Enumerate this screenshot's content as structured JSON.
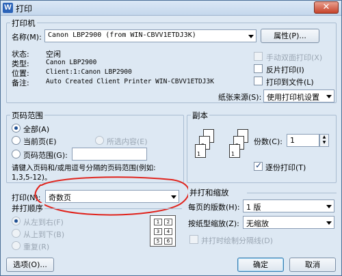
{
  "window": {
    "title": "打印",
    "app_icon": "W"
  },
  "printer": {
    "group_title": "打印机",
    "name_label": "名称(M):",
    "name_value": "Canon LBP2900 (from WIN-CBVV1ETDJ3K)",
    "properties_button": "属性(P)...",
    "status_label": "状态:",
    "status_value": "空闲",
    "type_label": "类型:",
    "type_value": "Canon LBP2900",
    "location_label": "位置:",
    "location_value": "Client:1:Canon LBP2900",
    "comment_label": "备注:",
    "comment_value": "Auto Created Client Printer WIN-CBVV1ETDJ3K",
    "manual_duplex": "手动双面打印(X)",
    "reverse_print": "反片打印(I)",
    "print_to_file": "打印到文件(L)",
    "paper_source_label": "纸张来源(S):",
    "paper_source_value": "使用打印机设置"
  },
  "page_range": {
    "group_title": "页码范围",
    "all": "全部(A)",
    "current": "当前页(E)",
    "selection": "所选内容(E)",
    "pages": "页码范围(G):",
    "pages_value": "",
    "hint_line1": "请键入页码和/或用逗号分隔的页码范围(例如:",
    "hint_line2": "1,3,5-12)。"
  },
  "print_what": {
    "label": "打印(N):",
    "value": "奇数页"
  },
  "collate_order": {
    "group_title": "并打顺序",
    "left_to_right": "从左到右(F)",
    "top_to_bottom": "从上到下(B)",
    "repeat": "重复(R)",
    "grid_labels": [
      "1",
      "2",
      "3",
      "4",
      "5",
      "6"
    ]
  },
  "copies": {
    "group_title": "副本",
    "count_label": "份数(C):",
    "count_value": "1",
    "collate": "逐份打印(T)",
    "page_labels": [
      "3",
      "2",
      "1",
      "3",
      "2",
      "1"
    ]
  },
  "zoom": {
    "group_title": "并打和缩放",
    "pages_per_sheet_label": "每页的版数(H):",
    "pages_per_sheet_value": "1 版",
    "scale_label": "按纸型缩放(Z):",
    "scale_value": "无缩放",
    "draw_borders": "并打时绘制分隔线(D)"
  },
  "footer": {
    "options_button": "选项(O)...",
    "ok_button": "确定",
    "cancel_button": "取消"
  },
  "annotation_color": "#e0231c"
}
